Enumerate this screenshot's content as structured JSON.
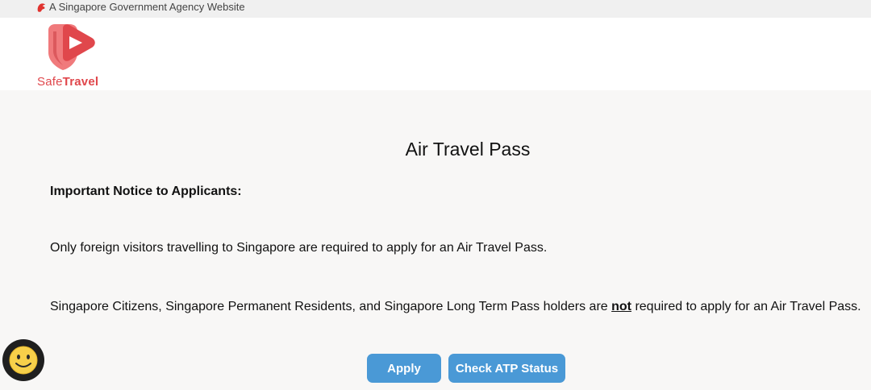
{
  "gov_bar": {
    "text": "A Singapore Government Agency Website",
    "icon": "lion-head-icon"
  },
  "logo": {
    "icon": "safetravel-play-shield-icon",
    "word1": "Safe",
    "word2": "Travel",
    "color": "#e0474c"
  },
  "main": {
    "title": "Air Travel Pass",
    "notice_heading": "Important Notice to Applicants:",
    "paragraph1": "Only foreign visitors travelling to Singapore are required to apply for an Air Travel Pass.",
    "paragraph2_before": "Singapore Citizens, Singapore Permanent Residents, and Singapore Long Term Pass holders are ",
    "paragraph2_emphasis": "not",
    "paragraph2_after": " required to apply for an Air Travel Pass."
  },
  "buttons": {
    "apply_label": "Apply",
    "check_status_label": "Check ATP Status",
    "color": "#4a99d6"
  },
  "chat_widget": {
    "icon": "smiley-face-icon"
  }
}
